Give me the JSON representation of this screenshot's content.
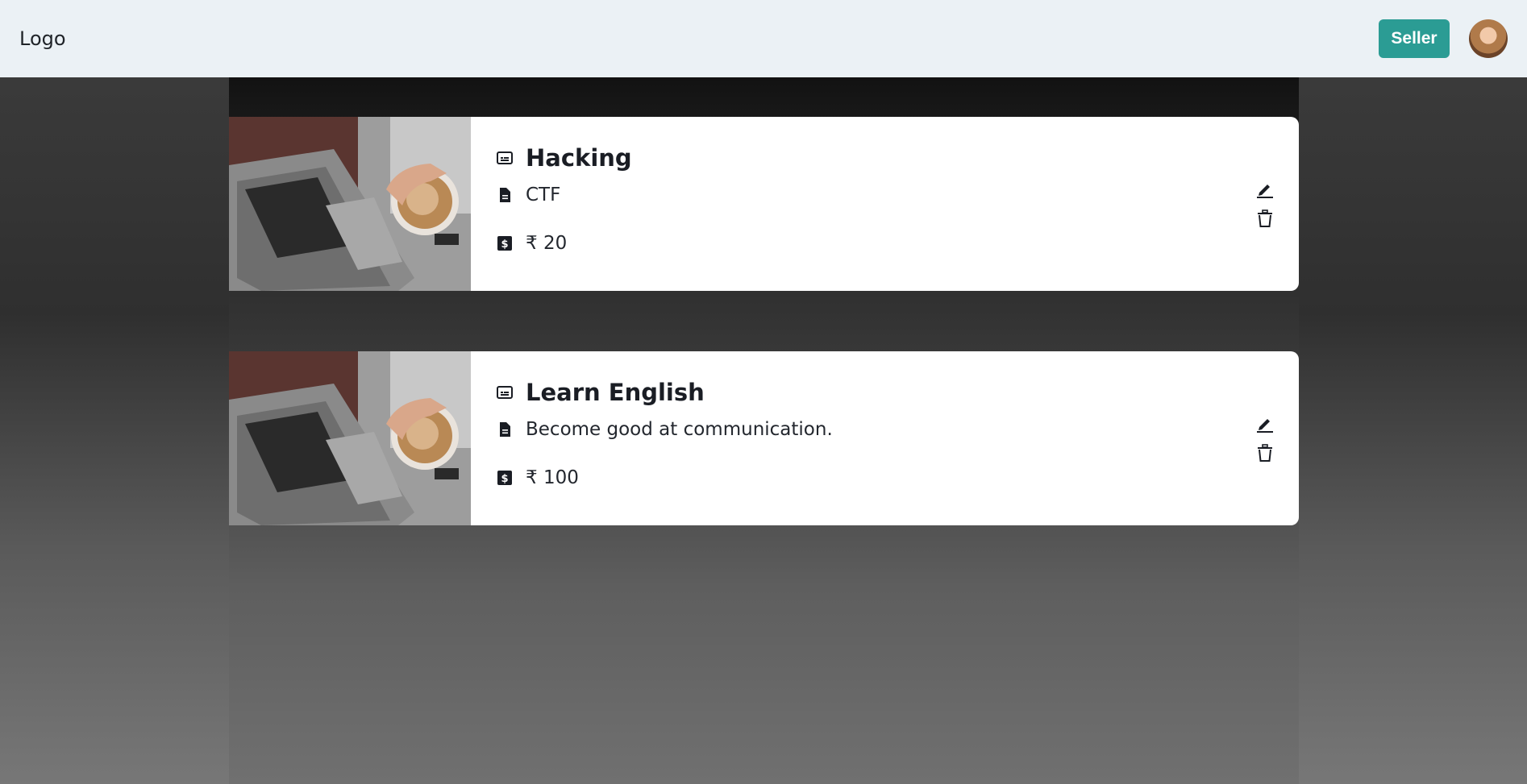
{
  "navbar": {
    "logo": "Logo",
    "seller_label": "Seller"
  },
  "courses": [
    {
      "title": "Hacking",
      "description": "CTF",
      "price": "₹ 20"
    },
    {
      "title": "Learn English",
      "description": "Become good at communication.",
      "price": "₹ 100"
    }
  ],
  "colors": {
    "navbar_bg": "#ebf1f5",
    "seller_button": "#2b9c94",
    "card_bg": "#ffffff",
    "text_dark": "#1a1d24"
  },
  "icons": [
    "title-icon",
    "description-icon",
    "price-icon",
    "edit-icon",
    "delete-icon"
  ]
}
